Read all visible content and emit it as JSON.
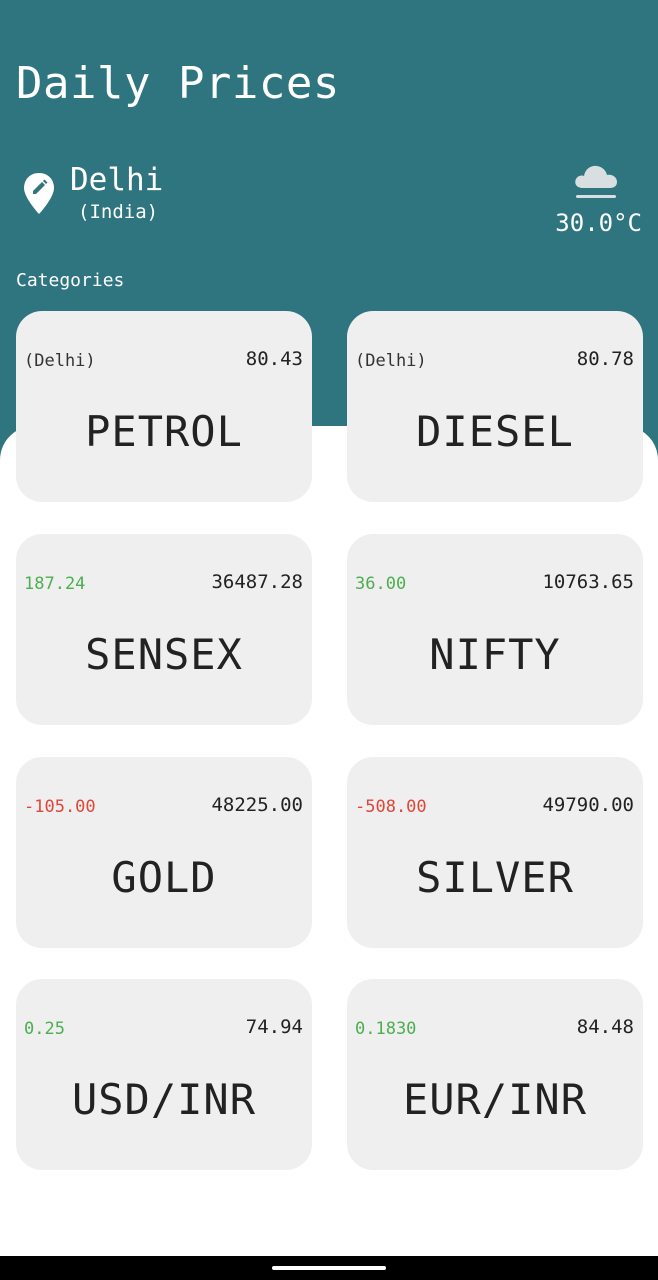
{
  "header": {
    "title": "Daily Prices",
    "location": {
      "city": "Delhi",
      "country": "(India)"
    },
    "weather": {
      "icon": "cloud-fog-icon",
      "temperature": "30.0°C"
    }
  },
  "categories_label": "Categories",
  "cards": [
    {
      "id": "petrol",
      "name": "PETROL",
      "change": "(Delhi)",
      "change_type": "neutral",
      "price": "80.43"
    },
    {
      "id": "diesel",
      "name": "DIESEL",
      "change": "(Delhi)",
      "change_type": "neutral",
      "price": "80.78"
    },
    {
      "id": "sensex",
      "name": "SENSEX",
      "change": "187.24",
      "change_type": "positive",
      "price": "36487.28"
    },
    {
      "id": "nifty",
      "name": "NIFTY",
      "change": "36.00",
      "change_type": "positive",
      "price": "10763.65"
    },
    {
      "id": "gold",
      "name": "GOLD",
      "change": "-105.00",
      "change_type": "negative",
      "price": "48225.00"
    },
    {
      "id": "silver",
      "name": "SILVER",
      "change": "-508.00",
      "change_type": "negative",
      "price": "49790.00"
    },
    {
      "id": "usd-inr",
      "name": "USD/INR",
      "change": "0.25",
      "change_type": "positive",
      "price": "74.94"
    },
    {
      "id": "eur-inr",
      "name": "EUR/INR",
      "change": "0.1830",
      "change_type": "positive",
      "price": "84.48"
    }
  ],
  "colors": {
    "header_bg": "#2e7580",
    "card_bg": "#efefef",
    "positive": "#4caf50",
    "negative": "#e0463a"
  }
}
